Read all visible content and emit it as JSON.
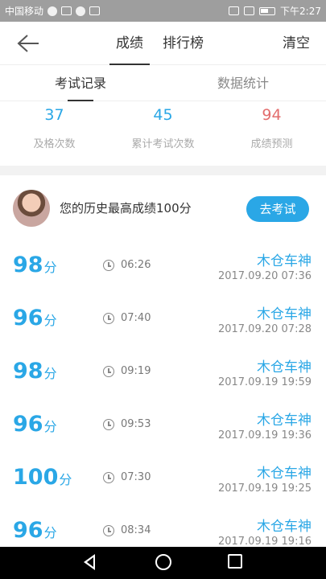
{
  "status_bar": {
    "carrier": "中国移动",
    "time": "下午2:27"
  },
  "header": {
    "tabs": [
      "成绩",
      "排行榜"
    ],
    "active_tab": 0,
    "clear_label": "清空"
  },
  "sub_tabs": {
    "record_label": "考试记录",
    "stats_label": "数据统计"
  },
  "stats": [
    {
      "value": "37",
      "label": "及格次数",
      "color": "#2aa7e6"
    },
    {
      "value": "45",
      "label": "累计考试次数",
      "color": "#2aa7e6"
    },
    {
      "value": "94",
      "label": "成绩预测",
      "color": "#e36d6d"
    }
  ],
  "best": {
    "text": "您的历史最高成绩100分",
    "button_label": "去考试"
  },
  "records": [
    {
      "score": "98",
      "unit": "分",
      "duration": "06:26",
      "name": "木仓车神",
      "date": "2017.09.20  07:36"
    },
    {
      "score": "96",
      "unit": "分",
      "duration": "07:40",
      "name": "木仓车神",
      "date": "2017.09.20  07:28"
    },
    {
      "score": "98",
      "unit": "分",
      "duration": "09:19",
      "name": "木仓车神",
      "date": "2017.09.19  19:59"
    },
    {
      "score": "96",
      "unit": "分",
      "duration": "09:53",
      "name": "木仓车神",
      "date": "2017.09.19  19:36"
    },
    {
      "score": "100",
      "unit": "分",
      "duration": "07:30",
      "name": "木仓车神",
      "date": "2017.09.19  19:25"
    },
    {
      "score": "96",
      "unit": "分",
      "duration": "08:34",
      "name": "木仓车神",
      "date": "2017.09.19  19:16"
    }
  ],
  "colors": {
    "accent": "#2aa7e6",
    "prediction": "#e36d6d"
  }
}
